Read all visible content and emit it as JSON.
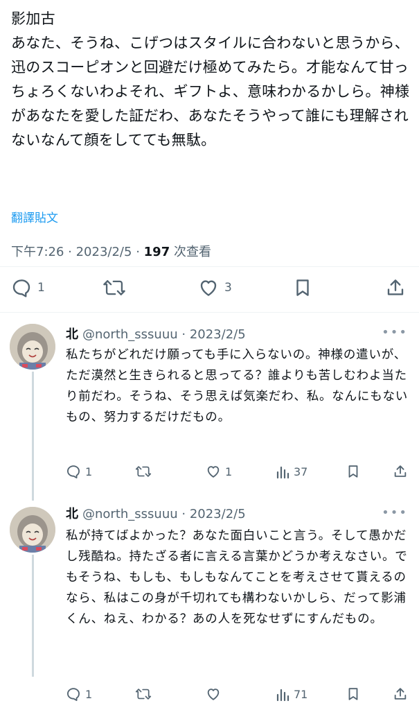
{
  "main_tweet": {
    "title_line": "影加古",
    "body": "あなた、そうね、こげつはスタイルに合わないと思うから、迅のスコーピオンと回避だけ極めてみたら。才能なんて甘っちょろくないわよそれ、ギフトよ、意味わかるかしら。神様があなたを愛した証だわ、あなたそうやって誰にも理解されないなんて顔をしてても無駄。",
    "translate_label": "翻譯貼文",
    "time": "下午7:26",
    "date": "2023/2/5",
    "views_count": "197",
    "views_label": "次查看",
    "reply_count": "1",
    "retweet_count": "",
    "like_count": "3"
  },
  "replies": [
    {
      "display_name": "北",
      "handle": "@north_sssuuu",
      "date": "2023/2/5",
      "text": "私たちがどれだけ願っても手に入らないの。神様の遣いが、ただ漠然と生きられると思ってる？誰よりも苦しむわよ当たり前だわ。そうね、そう思えば気楽だわ、私。なんにもないもの、努力するだけだもの。",
      "reply_count": "1",
      "retweet_count": "",
      "like_count": "1",
      "views_count": "37"
    },
    {
      "display_name": "北",
      "handle": "@north_sssuuu",
      "date": "2023/2/5",
      "text": "私が持てばよかった？あなた面白いこと言う。そして愚かだし残酷ね。持たざる者に言える言葉かどうか考えなさい。でもそうね、もしも、もしもなんてことを考えさせて貰えるのなら、私はこの身が千切れても構わないかしら、だって影浦くん、ねえ、わかる？あの人を死なせずにすんだもの。",
      "reply_count": "1",
      "retweet_count": "",
      "like_count": "",
      "views_count": "71"
    }
  ],
  "colors": {
    "accent": "#1d9bf0",
    "text": "#0f1419",
    "muted": "#536471",
    "divider": "#eff3f4"
  }
}
